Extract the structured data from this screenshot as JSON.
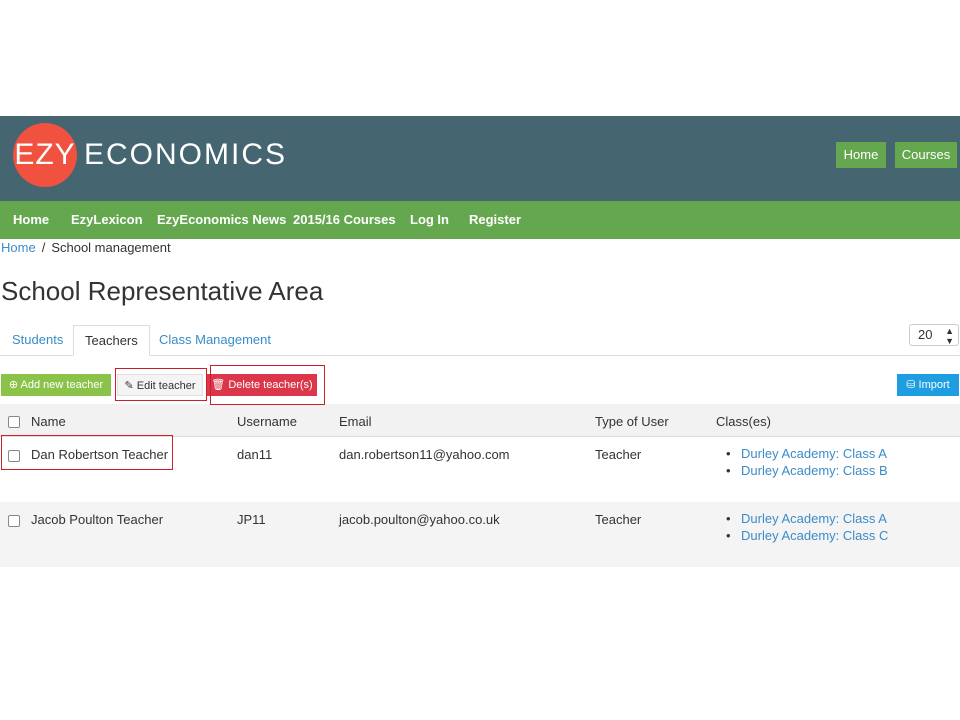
{
  "header": {
    "logo_mark": "EZY",
    "logo_word": "ECONOMICS",
    "buttons": [
      "Home",
      "Courses"
    ]
  },
  "nav": {
    "items": [
      "Home",
      "EzyLexicon",
      "EzyEconomics News",
      "2015/16 Courses",
      "Log In",
      "Register"
    ]
  },
  "breadcrumb": {
    "home": "Home",
    "separator": "/",
    "current": "School management"
  },
  "page_title": "School Representative Area",
  "tabs": [
    "Students",
    "Teachers",
    "Class Management"
  ],
  "active_tab": "Teachers",
  "page_size": "20",
  "toolbar": {
    "add": "Add new teacher",
    "edit": "Edit teacher",
    "delete": "Delete teacher(s)",
    "import": "Import"
  },
  "table": {
    "columns": [
      "Name",
      "Username",
      "Email",
      "Type of User",
      "Class(es)"
    ],
    "rows": [
      {
        "name": "Dan Robertson Teacher",
        "username": "dan11",
        "email": "dan.robertson11@yahoo.com",
        "type": "Teacher",
        "classes": [
          "Durley Academy: Class A",
          "Durley Academy: Class B"
        ]
      },
      {
        "name": "Jacob Poulton Teacher",
        "username": "JP11",
        "email": "jacob.poulton@yahoo.co.uk",
        "type": "Teacher",
        "classes": [
          "Durley Academy: Class A",
          "Durley Academy: Class C"
        ]
      }
    ]
  },
  "colors": {
    "brand_bar": "#456570",
    "nav_green": "#64a74e",
    "logo_red": "#f0523f",
    "add_button": "#8bc34a",
    "delete_button": "#db3649",
    "import_button": "#1e9ee0",
    "link": "#3a8cc8",
    "highlight_box": "#cc1f27"
  },
  "icons": {
    "add": "plus-circle-icon",
    "edit": "edit-icon",
    "delete": "trash-icon",
    "import": "database-icon"
  }
}
